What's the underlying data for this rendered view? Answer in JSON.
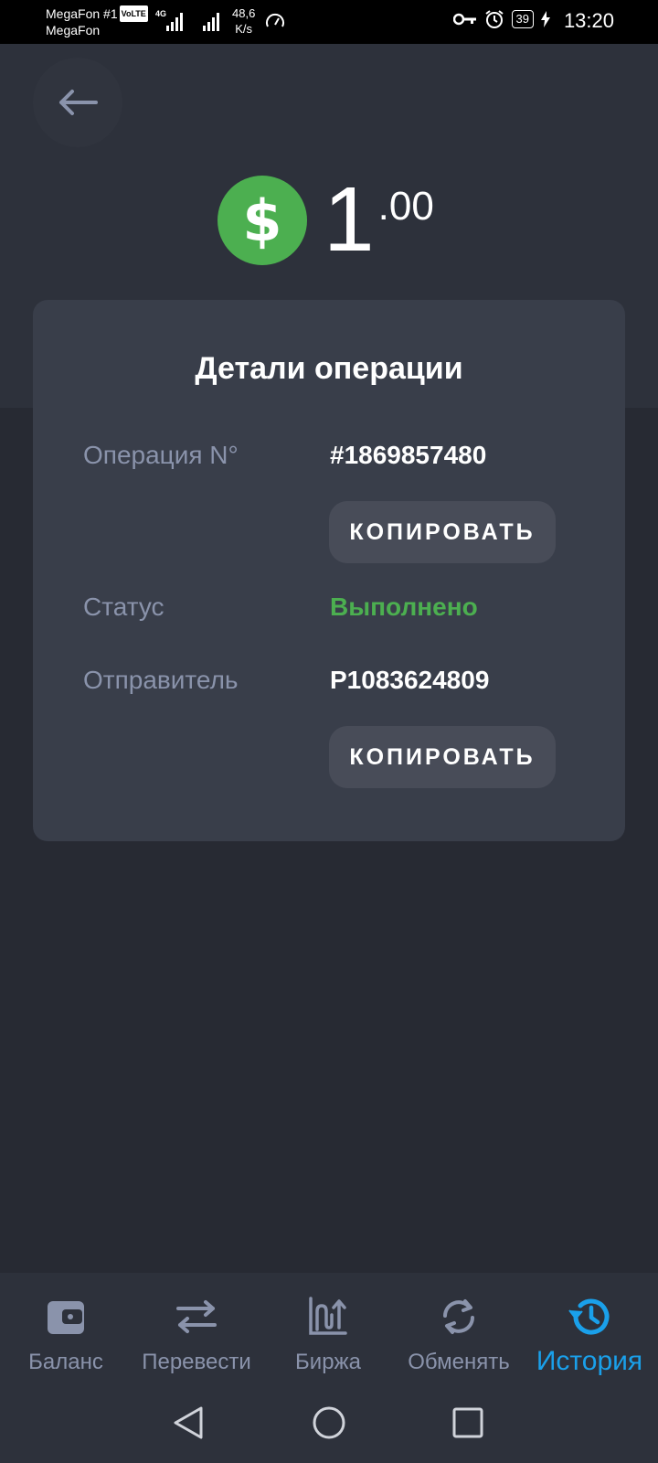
{
  "status_bar": {
    "carrier1": "MegaFon #1",
    "volte": "VoLTE",
    "carrier2": "MegaFon",
    "network": "4G",
    "speed_value": "48,6",
    "speed_unit": "K/s",
    "battery": "39",
    "time": "13:20"
  },
  "header": {
    "back_icon": "arrow-left-icon",
    "currency_icon": "dollar-coin-icon",
    "currency_symbol": "$",
    "amount_int": "1",
    "amount_frac": ".00"
  },
  "details": {
    "title": "Детали операции",
    "operation_label": "Операция N°",
    "operation_value": "#1869857480",
    "copy_label": "КОПИРОВАТЬ",
    "status_label": "Статус",
    "status_value": "Выполнено",
    "sender_label": "Отправитель",
    "sender_value": "P1083624809",
    "copy_label_2": "КОПИРОВАТЬ"
  },
  "bottom_nav": {
    "items": [
      {
        "label": "Баланс",
        "icon": "wallet-icon"
      },
      {
        "label": "Перевести",
        "icon": "transfer-arrows-icon"
      },
      {
        "label": "Биржа",
        "icon": "exchange-chart-icon"
      },
      {
        "label": "Обменять",
        "icon": "refresh-icon"
      },
      {
        "label": "История",
        "icon": "history-icon"
      }
    ],
    "active_index": 4
  },
  "colors": {
    "accent": "#1aa0ea",
    "success": "#4caf50",
    "background": "#272a33",
    "card": "#393e4a"
  }
}
